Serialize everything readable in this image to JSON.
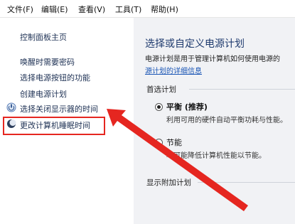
{
  "menubar": {
    "file": "文件(F)",
    "edit": "编辑(E)",
    "view": "查看(V)",
    "tools": "工具(T)",
    "help": "帮助(H)"
  },
  "sidebar": {
    "home": "控制面板主页",
    "items": [
      "唤醒时需要密码",
      "选择电源按钮的功能",
      "创建电源计划",
      "选择关闭显示器的时间",
      "更改计算机睡眠时间"
    ]
  },
  "main": {
    "title": "选择或自定义电源计划",
    "desc": "电源计划是用于管理计算机如何使用电源的",
    "link": "源计划的详细信息",
    "preferred_heading": "首选计划",
    "plans": [
      {
        "name": "平衡 (推荐)",
        "desc": "利用可用的硬件自动平衡功耗与性能。",
        "selected": true
      },
      {
        "name": "节能",
        "desc": "尽可能降低计算机性能以节能。",
        "selected": false
      }
    ],
    "more_heading": "显示附加计划"
  },
  "annotation": {
    "highlight_color": "#e52620"
  }
}
